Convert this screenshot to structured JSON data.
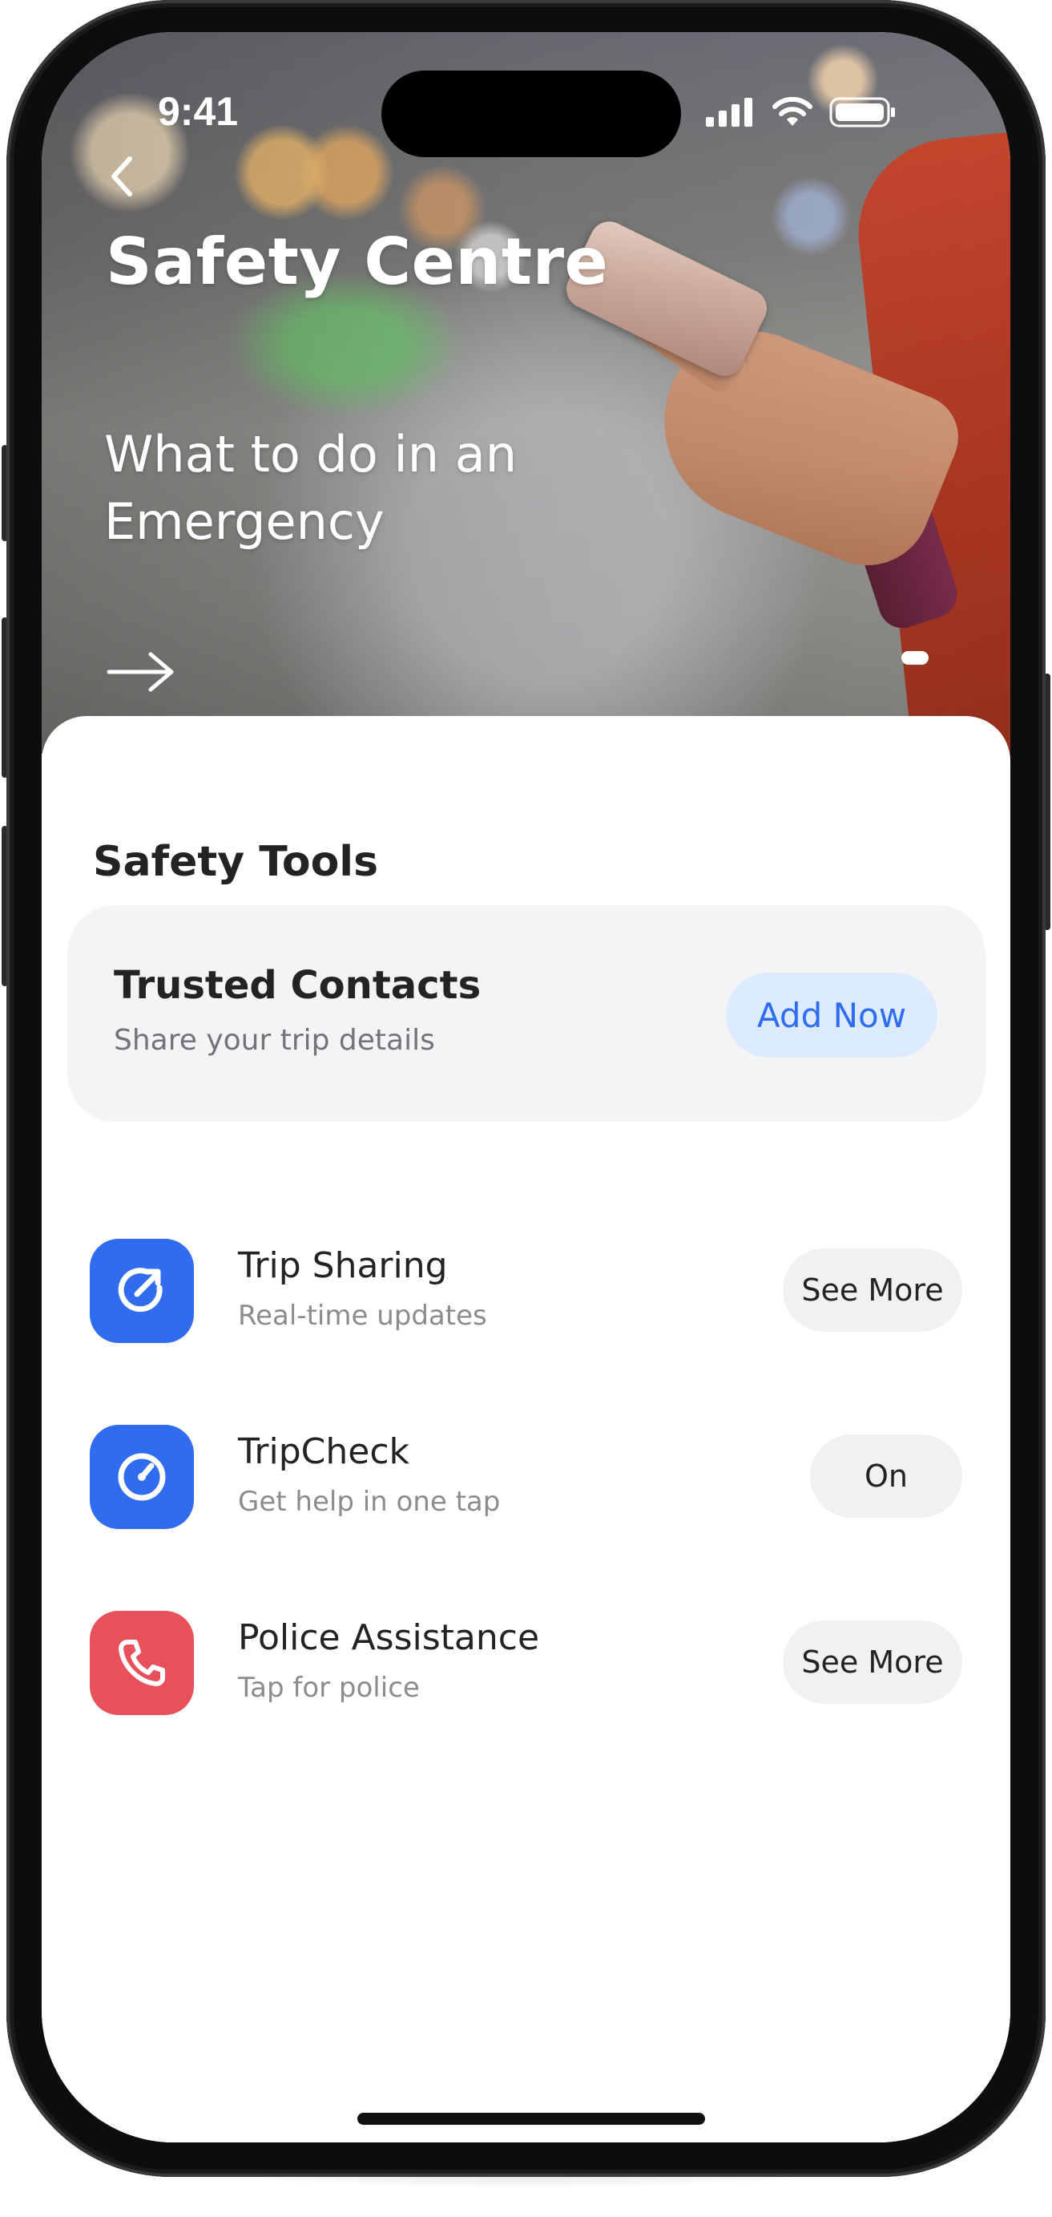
{
  "status_bar": {
    "time": "9:41"
  },
  "hero": {
    "title": "Safety Centre",
    "subtitle": "What to do in an Emergency"
  },
  "safety_tools": {
    "section_title": "Safety Tools",
    "trusted_contacts": {
      "title": "Trusted Contacts",
      "subtitle": "Share your trip details",
      "button_label": "Add Now"
    },
    "items": [
      {
        "title": "Trip Sharing",
        "subtitle": "Real-time updates",
        "action_label": "See More",
        "icon": "share-trip-icon",
        "icon_color": "#2f6cf0"
      },
      {
        "title": "TripCheck",
        "subtitle": "Get help in one tap",
        "action_label": "On",
        "icon": "tripcheck-gauge-icon",
        "icon_color": "#2f6cf0"
      },
      {
        "title": "Police Assistance",
        "subtitle": "Tap for police",
        "action_label": "See More",
        "icon": "phone-icon",
        "icon_color": "#e8505b"
      }
    ]
  },
  "colors": {
    "accent_blue": "#2f6cf0",
    "accent_blue_light": "#dcebff",
    "danger_red": "#e8505b",
    "text_primary": "#232325",
    "text_secondary": "#8b8b90"
  }
}
